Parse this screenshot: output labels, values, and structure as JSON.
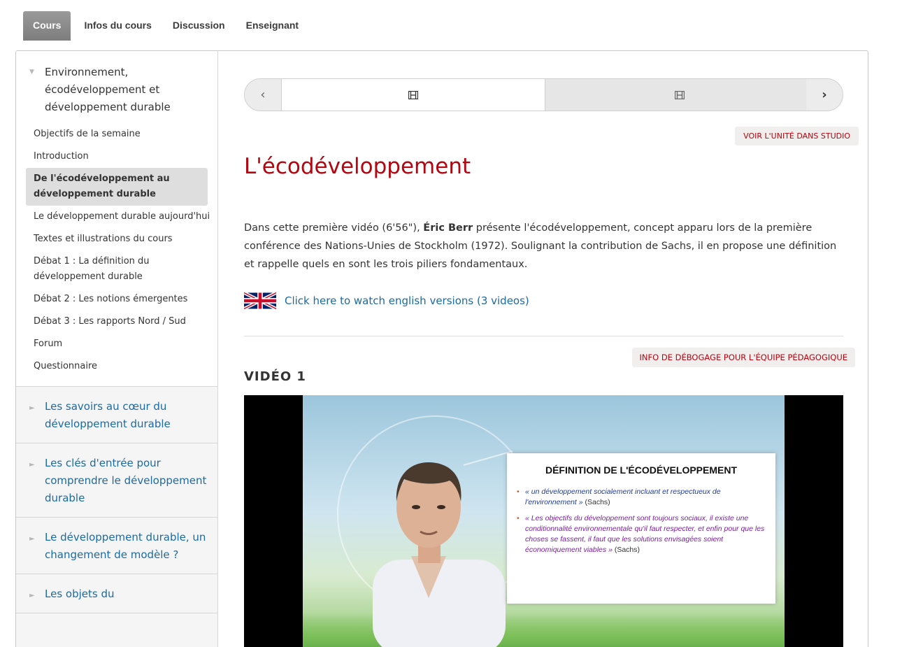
{
  "tabs": [
    {
      "label": "Cours",
      "active": true
    },
    {
      "label": "Infos du cours",
      "active": false
    },
    {
      "label": "Discussion",
      "active": false
    },
    {
      "label": "Enseignant",
      "active": false
    }
  ],
  "sidebar": {
    "open_chapter": {
      "title": "Environnement, écodéveloppement et développement durable",
      "sections": [
        {
          "label": "Objectifs de la semaine",
          "active": false
        },
        {
          "label": "Introduction",
          "active": false
        },
        {
          "label": "De l'écodéveloppement au développement durable",
          "active": true
        },
        {
          "label": "Le développement durable aujourd'hui",
          "active": false
        },
        {
          "label": "Textes et illustrations du cours",
          "active": false
        },
        {
          "label": "Débat 1 : La définition du développement durable",
          "active": false
        },
        {
          "label": "Débat 2 : Les notions émergentes",
          "active": false
        },
        {
          "label": "Débat 3 : Les rapports Nord / Sud",
          "active": false
        },
        {
          "label": "Forum",
          "active": false
        },
        {
          "label": "Questionnaire",
          "active": false
        }
      ]
    },
    "closed_chapters": [
      {
        "title": "Les savoirs au cœur du développement durable"
      },
      {
        "title": "Les clés d'entrée pour comprendre le développement durable"
      },
      {
        "title": "Le développement durable, un changement de modèle ?"
      },
      {
        "title": "Les objets du"
      }
    ]
  },
  "sequence_nav": {
    "prev_icon": "chevron-left-icon",
    "next_icon": "chevron-right-icon",
    "items": [
      {
        "icon": "film-icon",
        "active": true
      },
      {
        "icon": "film-icon",
        "active": false
      }
    ]
  },
  "studio_button": "VOIR L'UNITÉ DANS STUDIO",
  "unit_title": "L'écodéveloppement",
  "intro": {
    "before": "Dans cette première vidéo (6'56\"), ",
    "bold": "Éric Berr",
    "after": " présente l'écodéveloppement, concept apparu lors de la première conférence des Nations-Unies de Stockholm (1972). Soulignant la contribution de Sachs, il en propose une définition et rappelle quels en sont les trois piliers fondamentaux."
  },
  "english_link": "Click here to watch english versions (3 videos)",
  "debug_button": "INFO DE DÉBOGAGE POUR L'ÉQUIPE PÉDAGOGIQUE",
  "video": {
    "heading": "VIDÉO 1",
    "slide_title": "DÉFINITION DE L'ÉCODÉVELOPPEMENT",
    "slide_items": [
      {
        "text": "« un développement socialement incluant et respectueux de l'environnement »",
        "source": "(Sachs)"
      },
      {
        "text": "« Les objectifs du développement sont toujours sociaux, il existe une conditionnalité environnementale qu'il faut respecter, et enfin pour que les choses se fassent, il faut que les solutions envisagées soient économiquement viables »",
        "source": "(Sachs)"
      }
    ]
  },
  "colors": {
    "accent_red": "#b20610",
    "link_blue": "#1b6aa5"
  }
}
